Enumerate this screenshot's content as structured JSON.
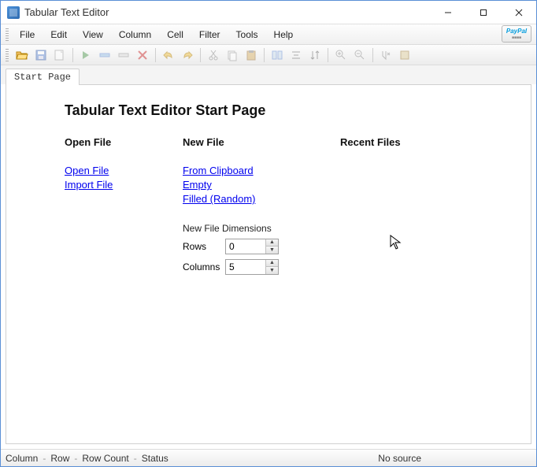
{
  "window": {
    "title": "Tabular Text Editor"
  },
  "menu": {
    "file": "File",
    "edit": "Edit",
    "view": "View",
    "column": "Column",
    "cell": "Cell",
    "filter": "Filter",
    "tools": "Tools",
    "help": "Help"
  },
  "paypal": {
    "top": "Pay",
    "top2": "Pal",
    "bottom": "■■■■"
  },
  "tab": {
    "start": "Start Page"
  },
  "page": {
    "title": "Tabular Text Editor Start Page",
    "open": {
      "heading": "Open File",
      "open_file": "Open File",
      "import_file": "Import File"
    },
    "newf": {
      "heading": "New File",
      "from_clipboard": "From Clipboard",
      "empty": "Empty",
      "filled_random": "Filled (Random)",
      "dimensions_label": "New File Dimensions",
      "rows_label": "Rows",
      "rows_value": "0",
      "cols_label": "Columns",
      "cols_value": "5"
    },
    "recent": {
      "heading": "Recent Files"
    }
  },
  "status": {
    "column": "Column",
    "dash1": "-",
    "row": "Row",
    "dash2": "-",
    "row_count": "Row Count",
    "dash3": "-",
    "status": "Status",
    "source": "No source"
  }
}
